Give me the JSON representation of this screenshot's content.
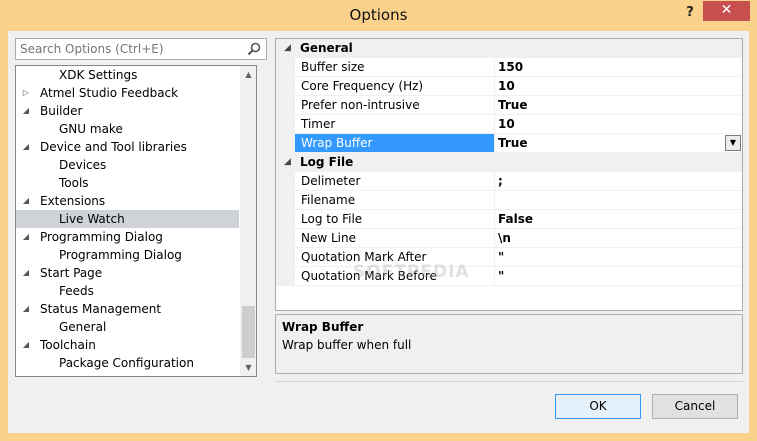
{
  "window": {
    "title": "Options",
    "help_glyph": "?",
    "close_glyph": "✕"
  },
  "search": {
    "placeholder": "Search Options (Ctrl+E)"
  },
  "tree": {
    "items": [
      {
        "label": "XDK Settings",
        "level": 1,
        "caret": ""
      },
      {
        "label": "Atmel Studio Feedback",
        "level": 0,
        "caret": "▷"
      },
      {
        "label": "Builder",
        "level": 0,
        "caret": "◢"
      },
      {
        "label": "GNU make",
        "level": 1,
        "caret": ""
      },
      {
        "label": "Device and Tool libraries",
        "level": 0,
        "caret": "◢"
      },
      {
        "label": "Devices",
        "level": 1,
        "caret": ""
      },
      {
        "label": "Tools",
        "level": 1,
        "caret": ""
      },
      {
        "label": "Extensions",
        "level": 0,
        "caret": "◢"
      },
      {
        "label": "Live Watch",
        "level": 1,
        "caret": "",
        "selected": true
      },
      {
        "label": "Programming Dialog",
        "level": 0,
        "caret": "◢"
      },
      {
        "label": "Programming Dialog",
        "level": 1,
        "caret": ""
      },
      {
        "label": "Start Page",
        "level": 0,
        "caret": "◢"
      },
      {
        "label": "Feeds",
        "level": 1,
        "caret": ""
      },
      {
        "label": "Status Management",
        "level": 0,
        "caret": "◢"
      },
      {
        "label": "General",
        "level": 1,
        "caret": ""
      },
      {
        "label": "Toolchain",
        "level": 0,
        "caret": "◢"
      },
      {
        "label": "Package Configuration",
        "level": 1,
        "caret": ""
      }
    ]
  },
  "grid": {
    "categories": [
      {
        "label": "General",
        "toggle": "◢",
        "props": [
          {
            "name": "Buffer size",
            "value": "150"
          },
          {
            "name": "Core Frequency (Hz)",
            "value": "10"
          },
          {
            "name": "Prefer non-intrusive",
            "value": "True"
          },
          {
            "name": "Timer",
            "value": "10"
          },
          {
            "name": "Wrap Buffer",
            "value": "True",
            "selected": true,
            "dropdown": "▼"
          }
        ]
      },
      {
        "label": "Log File",
        "toggle": "◢",
        "props": [
          {
            "name": "Delimeter",
            "value": ";"
          },
          {
            "name": "Filename",
            "value": ""
          },
          {
            "name": "Log to File",
            "value": "False"
          },
          {
            "name": "New Line",
            "value": "\\n"
          },
          {
            "name": "Quotation Mark After",
            "value": "\""
          },
          {
            "name": "Quotation Mark Before",
            "value": "\""
          }
        ]
      }
    ]
  },
  "description": {
    "title": "Wrap Buffer",
    "text": "Wrap buffer when full"
  },
  "buttons": {
    "ok": "OK",
    "cancel": "Cancel"
  },
  "watermark": "SOFTPEDIA"
}
